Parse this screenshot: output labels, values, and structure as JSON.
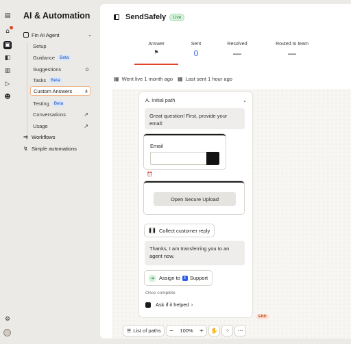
{
  "rail": {
    "icons": [
      "inbox-icon",
      "notifications-icon",
      "fin-icon",
      "knowledge-icon",
      "reports-icon",
      "outbound-icon",
      "contacts-icon",
      "settings-icon"
    ]
  },
  "nav": {
    "title": "AI & Automation",
    "group_label": "Fin AI Agent",
    "items": [
      {
        "label": "Setup"
      },
      {
        "label": "Guidance",
        "badge": "Beta"
      },
      {
        "label": "Suggestions",
        "count": "0"
      },
      {
        "label": "Tasks",
        "badge": "Beta"
      },
      {
        "label": "Custom Answers",
        "count": "4"
      },
      {
        "label": "Testing",
        "badge": "Beta"
      },
      {
        "label": "Conversations"
      },
      {
        "label": "Usage"
      }
    ],
    "workflows": "Workflows",
    "simple_automations": "Simple automations"
  },
  "header": {
    "title": "SendSafely",
    "status": "Live"
  },
  "stats": {
    "answer": "Answer",
    "sent": "Sent",
    "sent_value": "0",
    "resolved": "Resolved",
    "resolved_value": "—",
    "routed": "Routed to team",
    "routed_value": "—"
  },
  "meta": {
    "live": "Went live 1 month ago",
    "sent": "Last sent 1 hour ago"
  },
  "flow": {
    "path_label": "A. Initial path",
    "bubble1": "Great question! First, provide your email:",
    "email_label": "Email",
    "upload_button": "Open Secure Upload",
    "collect_reply": "Collect customer reply",
    "bubble2": "Thanks, I am transferring you to an agent now.",
    "assign_to": "Assign to",
    "assign_team_initial": "I",
    "assign_team": "Support",
    "once_complete": "Once complete",
    "ask_helped": "Ask if it helped",
    "end_tag": "END"
  },
  "toolbar": {
    "list_of_paths": "List of paths",
    "zoom": "100%"
  }
}
